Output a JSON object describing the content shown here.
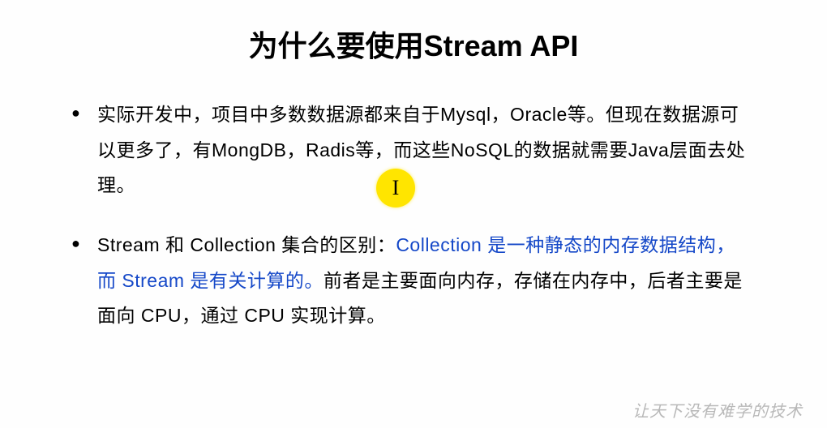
{
  "title": "为什么要使用Stream API",
  "bullets": [
    {
      "pre": "实际开发中，项目中多数数据源都来自于Mysql，Oracle等。但现在数据源可以更多了，有MongDB，Radis等，而这些NoSQL的数据就需要Java层面去处理。",
      "blue": "",
      "post": ""
    },
    {
      "pre": "Stream 和 Collection 集合的区别：",
      "blue": "Collection 是一种静态的内存数据结构，而 Stream 是有关计算的。",
      "post": "前者是主要面向内存，存储在内存中，后者主要是面向 CPU，通过 CPU 实现计算。"
    }
  ],
  "watermark": "让天下没有难学的技术",
  "cursor_char": "I"
}
